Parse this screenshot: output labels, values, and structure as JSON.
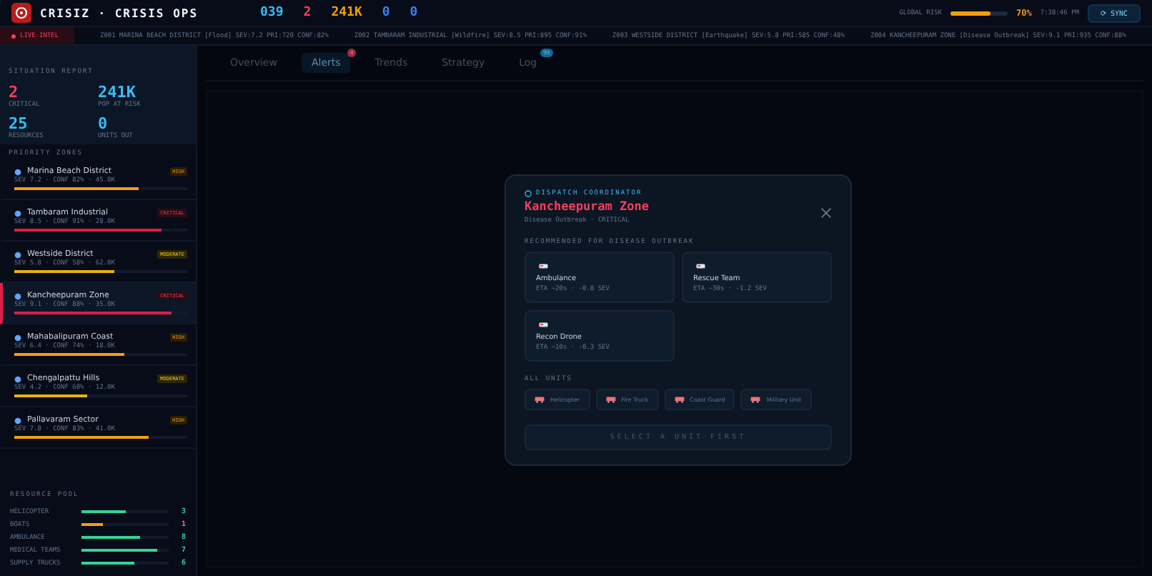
{
  "header": {
    "title": "CRISIZ · CRISIS OPS",
    "stats": [
      {
        "value": "039",
        "color": "#38bdf8"
      },
      {
        "value": "2",
        "color": "#f43f5e"
      },
      {
        "value": "241K",
        "color": "#f59e0b"
      },
      {
        "value": "0",
        "color": "#3b82f6"
      },
      {
        "value": "0",
        "color": "#3b82f6"
      }
    ],
    "global_risk": {
      "label": "GLOBAL RISK",
      "level": 0.7,
      "reading": "70%"
    },
    "time": "7:38:46 PM",
    "sync_button": "⟳ SYNC"
  },
  "ticker": {
    "badge": "LIVE INTEL",
    "items": [
      "Z001 MARINA BEACH DISTRICT [Flood] SEV:7.2 PRI:720 CONF:82%",
      "Z002 TAMBARAM INDUSTRIAL [Wildfire] SEV:8.5 PRI:895 CONF:91%",
      "Z003 WESTSIDE DISTRICT [Earthquake] SEV:5.8 PRI:585 CONF:48%",
      "Z004 KANCHEEPURAM ZONE [Disease Outbreak] SEV:9.1 PRI:935 CONF:88%"
    ]
  },
  "situation_report": {
    "title": "SITUATION REPORT",
    "stats": [
      {
        "value": "2",
        "label": "CRITICAL",
        "color": "#f43f5e"
      },
      {
        "value": "241K",
        "label": "POP AT RISK",
        "color": "#38bdf8"
      },
      {
        "value": "25",
        "label": "RESOURCES",
        "color": "#38bdf8"
      },
      {
        "value": "0",
        "label": "UNITS OUT",
        "color": "#38bdf8"
      }
    ]
  },
  "priority_zones": {
    "title": "PRIORITY ZONES",
    "items": [
      {
        "name": "Marina Beach District",
        "badge": "HIGH",
        "meta": "SEV 7.2 · CONF 82% · 45.0K",
        "level": 0.72,
        "selected": false
      },
      {
        "name": "Tambaram Industrial",
        "badge": "CRITICAL",
        "meta": "SEV 8.5 · CONF 91% · 28.0K",
        "level": 0.85,
        "selected": false
      },
      {
        "name": "Westside District",
        "badge": "MODERATE",
        "meta": "SEV 5.8 · CONF 58% · 62.0K",
        "level": 0.58,
        "selected": false
      },
      {
        "name": "Kancheepuram Zone",
        "badge": "CRITICAL",
        "meta": "SEV 9.1 · CONF 88% · 35.0K",
        "level": 0.91,
        "selected": true
      },
      {
        "name": "Mahabalipuram Coast",
        "badge": "HIGH",
        "meta": "SEV 6.4 · CONF 74% · 18.0K",
        "level": 0.64,
        "selected": false
      },
      {
        "name": "Chengalpattu Hills",
        "badge": "MODERATE",
        "meta": "SEV 4.2 · CONF 60% · 12.0K",
        "level": 0.42,
        "selected": false
      },
      {
        "name": "Pallavaram Sector",
        "badge": "HIGH",
        "meta": "SEV 7.8 · CONF 83% · 41.0K",
        "level": 0.78,
        "selected": false
      }
    ]
  },
  "resource_pool": {
    "title": "RESOURCE POOL",
    "items": [
      {
        "name": "HELICOPTER",
        "level": 0.5,
        "count": "3",
        "low": false
      },
      {
        "name": "BOATS",
        "level": 0.25,
        "count": "1",
        "low": true
      },
      {
        "name": "AMBULANCE",
        "level": 0.67,
        "count": "8",
        "low": false
      },
      {
        "name": "MEDICAL TEAMS",
        "level": 0.87,
        "count": "7",
        "low": false
      },
      {
        "name": "SUPPLY TRUCKS",
        "level": 0.6,
        "count": "6",
        "low": false
      }
    ]
  },
  "tabs": [
    {
      "label": "Overview",
      "selected": false
    },
    {
      "label": "Alerts",
      "selected": true,
      "badge": "4"
    },
    {
      "label": "Trends",
      "selected": false
    },
    {
      "label": "Strategy",
      "selected": false
    },
    {
      "label": "Log",
      "selected": false,
      "badge": "99"
    }
  ],
  "dialog": {
    "eyebrow": "DISPATCH COORDINATOR",
    "title": "Kancheepuram Zone",
    "subtitle": "Disease Outbreak · CRITICAL",
    "recommended_label": "RECOMMENDED FOR DISEASE OUTBREAK",
    "recommended": [
      {
        "name": "Ambulance",
        "meta": "ETA ~20s · -0.8 SEV"
      },
      {
        "name": "Rescue Team",
        "meta": "ETA ~30s · -1.2 SEV"
      },
      {
        "name": "Recon Drone",
        "meta": "ETA ~10s · -0.3 SEV"
      }
    ],
    "all_units_label": "ALL UNITS",
    "all_units": [
      "Helicopter",
      "Fire Truck",
      "Coast Guard",
      "Military Unit"
    ],
    "confirm_button": {
      "label": "SELECT A UNIT FIRST",
      "disabled": true
    }
  }
}
